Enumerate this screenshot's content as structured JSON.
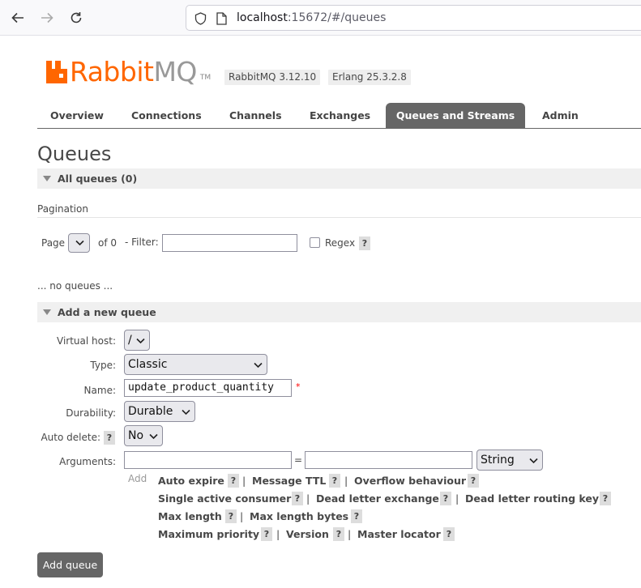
{
  "browser": {
    "url_host": "localhost",
    "url_rest": ":15672/#/queues"
  },
  "header": {
    "logo_rabbit": "Rabbit",
    "logo_mq": "MQ",
    "logo_tm": "TM",
    "version": "RabbitMQ 3.12.10",
    "erlang": "Erlang 25.3.2.8"
  },
  "tabs": [
    {
      "label": "Overview"
    },
    {
      "label": "Connections"
    },
    {
      "label": "Channels"
    },
    {
      "label": "Exchanges"
    },
    {
      "label": "Queues and Streams",
      "active": true
    },
    {
      "label": "Admin"
    }
  ],
  "page_title": "Queues",
  "all_queues": {
    "header": "All queues (0)",
    "pagination_label": "Pagination",
    "page_label": "Page",
    "page_value": "",
    "of_label": "of 0",
    "filter_label": "- Filter:",
    "filter_value": "",
    "regex_label": "Regex",
    "help": "?",
    "empty_text": "... no queues ..."
  },
  "add_queue": {
    "header": "Add a new queue",
    "virtual_host_label": "Virtual host:",
    "virtual_host_value": "/",
    "type_label": "Type:",
    "type_value": "Classic",
    "name_label": "Name:",
    "name_value": "update_product_quantity",
    "required_mark": "*",
    "durability_label": "Durability:",
    "durability_value": "Durable",
    "auto_delete_label": "Auto delete:",
    "auto_delete_help": "?",
    "auto_delete_value": "No",
    "arguments_label": "Arguments:",
    "arg_key_value": "",
    "equals": "=",
    "arg_value_value": "",
    "arg_type_value": "String",
    "add_label": "Add",
    "arg_links": {
      "auto_expire": "Auto expire",
      "message_ttl": "Message TTL",
      "overflow_behaviour": "Overflow behaviour",
      "single_active_consumer": "Single active consumer",
      "dead_letter_exchange": "Dead letter exchange",
      "dead_letter_routing_key": "Dead letter routing key",
      "max_length": "Max length",
      "max_length_bytes": "Max length bytes",
      "maximum_priority": "Maximum priority",
      "version": "Version",
      "master_locator": "Master locator"
    },
    "help": "?",
    "separator": "|",
    "submit_label": "Add queue"
  },
  "colors": {
    "brand_orange": "#ff6600",
    "tab_active_bg": "#666666",
    "section_bg": "#f0f0f0"
  }
}
